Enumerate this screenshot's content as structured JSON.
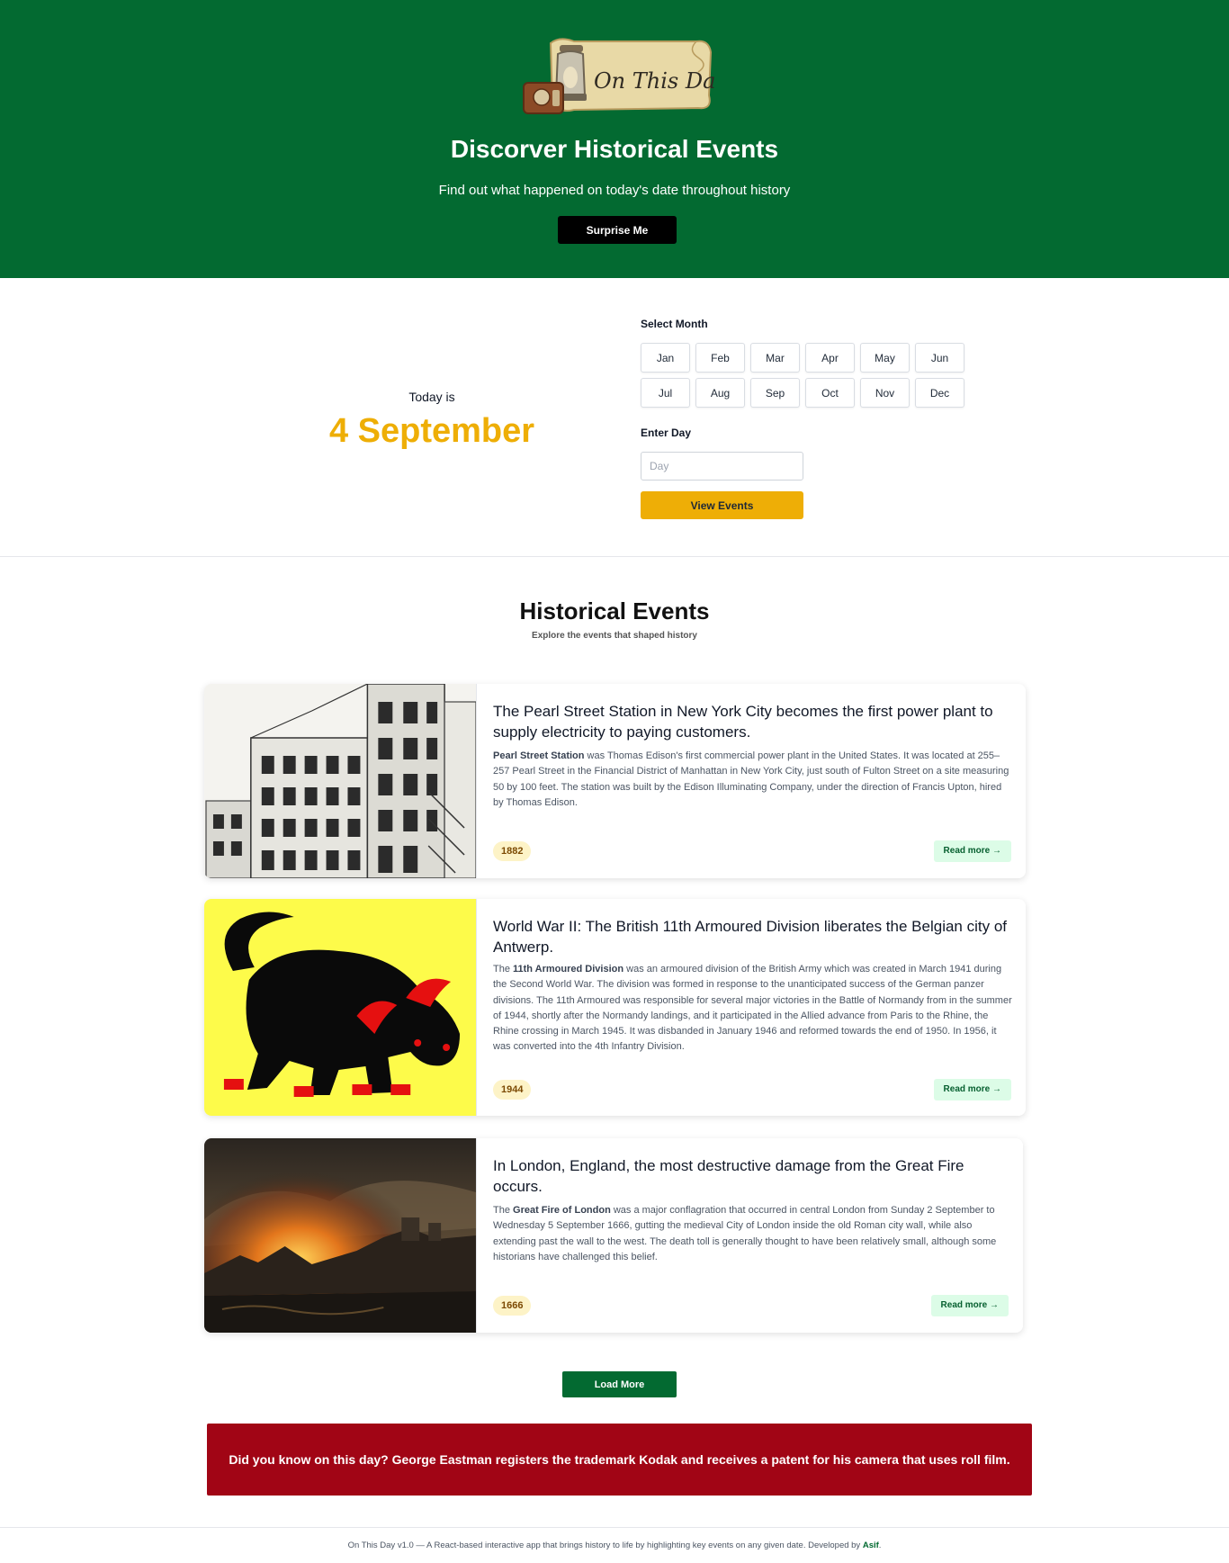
{
  "hero": {
    "logo_text": "On This Day",
    "title": "Discorver Historical Events",
    "subtitle": "Find out what happened on today's date throughout history",
    "surprise_label": "Surprise Me"
  },
  "today": {
    "label": "Today is",
    "date": "4 September"
  },
  "selector": {
    "month_label": "Select Month",
    "months": [
      "Jan",
      "Feb",
      "Mar",
      "Apr",
      "May",
      "Jun",
      "Jul",
      "Aug",
      "Sep",
      "Oct",
      "Nov",
      "Dec"
    ],
    "day_label": "Enter Day",
    "day_placeholder": "Day",
    "view_label": "View Events"
  },
  "events_header": {
    "title": "Historical Events",
    "subtitle": "Explore the events that shaped history"
  },
  "events": [
    {
      "title": "The Pearl Street Station in New York City becomes the first power plant to supply electricity to paying customers.",
      "desc_prefix": "",
      "desc_bold": "Pearl Street Station",
      "desc_rest": " was Thomas Edison's first commercial power plant in the United States. It was located at 255–257 Pearl Street in the Financial District of Manhattan in New York City, just south of Fulton Street on a site measuring 50 by 100 feet. The station was built by the Edison Illuminating Company, under the direction of Francis Upton, hired by Thomas Edison.",
      "year": "1882",
      "read_more": "Read more →",
      "image": "building-sketch-image"
    },
    {
      "title": "World War II: The British 11th Armoured Division liberates the Belgian city of Antwerp.",
      "desc_prefix": "The ",
      "desc_bold": "11th Armoured Division",
      "desc_rest": " was an armoured division of the British Army which was created in March 1941 during the Second World War. The division was formed in response to the unanticipated success of the German panzer divisions. The 11th Armoured was responsible for several major victories in the Battle of Normandy from in the summer of 1944, shortly after the Normandy landings, and it participated in the Allied advance from Paris to the Rhine, the Rhine crossing in March 1945. It was disbanded in January 1946 and reformed towards the end of 1950. In 1956, it was converted into the 4th Infantry Division.",
      "year": "1944",
      "read_more": "Read more →",
      "image": "black-bull-insignia-image"
    },
    {
      "title": "In London, England, the most destructive damage from the Great Fire occurs.",
      "desc_prefix": "The ",
      "desc_bold": "Great Fire of London",
      "desc_rest": " was a major conflagration that occurred in central London from Sunday 2 September to Wednesday 5 September 1666, gutting the medieval City of London inside the old Roman city wall, while also extending past the wall to the west. The death toll is generally thought to have been relatively small, although some historians have challenged this belief.",
      "year": "1666",
      "read_more": "Read more →",
      "image": "great-fire-painting-image"
    }
  ],
  "load_more": "Load More",
  "did_you_know": "Did you know on this day? George Eastman registers the trademark Kodak and receives a patent for his camera that uses roll film.",
  "footer": {
    "text": "On This Day v1.0 — A React-based interactive app that brings history to life by highlighting key events on any given date. Developed by ",
    "author": "Asif",
    "end": "."
  },
  "colors": {
    "brand_green": "#036a31",
    "accent_gold": "#eeae06",
    "fact_red": "#a10515"
  }
}
